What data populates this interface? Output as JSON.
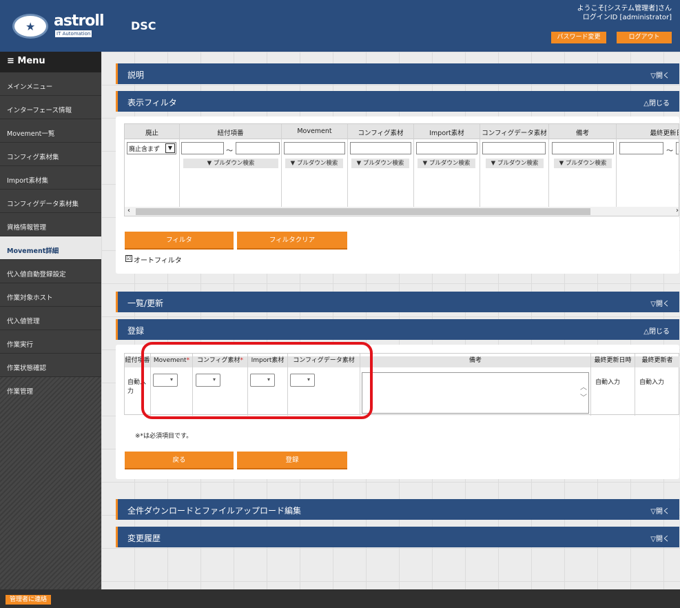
{
  "header": {
    "logo_text": "astroll",
    "logo_sub": "IT Automation",
    "app_title": "DSC",
    "welcome_line1": "ようこそ[システム管理者]さん",
    "welcome_line2": "ログインID [administrator]",
    "password_button": "パスワード変更",
    "logout_button": "ログアウト"
  },
  "sidebar": {
    "menu_label": "Menu",
    "items": [
      "メインメニュー",
      "インターフェース情報",
      "Movement一覧",
      "コンフィグ素材集",
      "Import素材集",
      "コンフィグデータ素材集",
      "資格情報管理",
      "Movement詳細",
      "代入値自動登録設定",
      "作業対象ホスト",
      "代入値管理",
      "作業実行",
      "作業状態確認",
      "作業管理"
    ],
    "active_index": 7
  },
  "sections": {
    "description": {
      "title": "説明",
      "toggle": "▽開く"
    },
    "filter": {
      "title": "表示フィルタ",
      "toggle": "△閉じる"
    },
    "list": {
      "title": "一覧/更新",
      "toggle": "▽開く"
    },
    "register": {
      "title": "登録",
      "toggle": "△閉じる"
    },
    "download": {
      "title": "全件ダウンロードとファイルアップロード編集",
      "toggle": "▽開く"
    },
    "history": {
      "title": "変更履歴",
      "toggle": "▽開く"
    }
  },
  "filter": {
    "columns": [
      "廃止",
      "紐付項番",
      "Movement",
      "コンフィグ素材",
      "Import素材",
      "コンフィグデータ素材",
      "備考",
      "最終更新日"
    ],
    "discard_select": "廃止含まず",
    "range_sep": "～",
    "pulldown_label": "▼ プルダウン検索",
    "filter_button": "フィルタ",
    "clear_button": "フィルタクリア",
    "auto_filter_label": "オートフィルタ",
    "auto_filter_checked": "☑"
  },
  "register": {
    "columns": {
      "link_no": "紐付項番",
      "movement": "Movement",
      "config": "コンフィグ素材",
      "import": "Import素材",
      "config_data": "コンフィグデータ素材",
      "remarks": "備考",
      "last_update_date": "最終更新日時",
      "last_updater": "最終更新者"
    },
    "required_mark": "*",
    "auto_input": "自動入力",
    "required_note": "※*は必須項目です。",
    "back_button": "戻る",
    "register_button": "登録"
  },
  "footer": {
    "contact_button": "管理者に連絡"
  },
  "colors": {
    "header": "#2a4d7e",
    "accent": "#f28a22",
    "highlight": "#e2141b"
  }
}
